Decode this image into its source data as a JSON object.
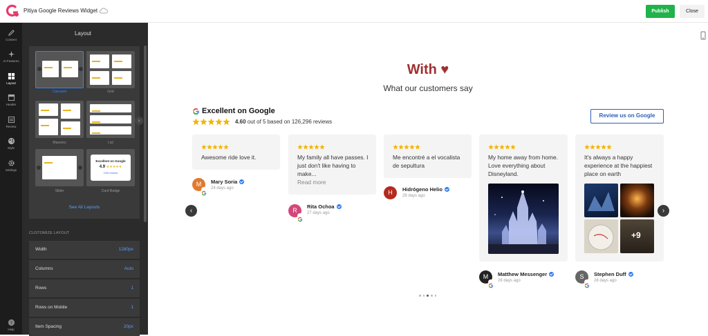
{
  "app": {
    "title": "Pitiya Google Reviews Widget",
    "publish_label": "Publish",
    "close_label": "Close"
  },
  "rail": [
    {
      "label": "Content",
      "icon": "pencil-icon"
    },
    {
      "label": "AI Features",
      "icon": "sparkle-icon"
    },
    {
      "label": "Layout",
      "icon": "layout-grid-icon"
    },
    {
      "label": "Header",
      "icon": "header-icon"
    },
    {
      "label": "Review",
      "icon": "review-icon"
    },
    {
      "label": "Style",
      "icon": "palette-icon"
    },
    {
      "label": "Settings",
      "icon": "gear-icon"
    },
    {
      "label": "Help",
      "icon": "help-icon"
    }
  ],
  "panel": {
    "title": "Layout",
    "layouts": [
      "Carousel",
      "Grid",
      "Masonry",
      "List",
      "Slider",
      "Card Badge"
    ],
    "selected": "Carousel",
    "badge_text": "Excellent on Google",
    "badge_rating": "4.9",
    "badge_link": "1000 reviews",
    "see_all": "See All Layouts",
    "customize_title": "CUSTOMIZE LAYOUT",
    "settings": [
      {
        "label": "Width",
        "value": "1280px"
      },
      {
        "label": "Columns",
        "value": "Auto"
      },
      {
        "label": "Rows",
        "value": "1"
      },
      {
        "label": "Rows on Mobile",
        "value": "1"
      },
      {
        "label": "Item Spacing",
        "value": "20px"
      }
    ]
  },
  "widget": {
    "heading": "With ♥",
    "subheading": "What our customers say",
    "summary_title": "Excellent on Google",
    "rating": "4.60",
    "rating_rest": " out of 5 based on 126,296 reviews",
    "review_button": "Review us on Google",
    "read_more": "Read more",
    "plus_more": "+9",
    "reviews": [
      {
        "text": "Awesome ride love it.",
        "author": "Mary Soria",
        "initial": "M",
        "date": "24 days ago",
        "color": "#e07a2e"
      },
      {
        "text": "My family all have passes. I just don't like having to make...",
        "author": "Rita Ochoa",
        "initial": "R",
        "date": "27 days ago",
        "color": "#d4477a"
      },
      {
        "text": "Me encontré a el vocalista de sepultura",
        "author": "Hidrógeno Helio",
        "initial": "H",
        "date": "28 days ago",
        "color": "#b52a1e"
      },
      {
        "text": "My home away from home. Love everything about Disneyland.",
        "author": "Matthew Messenger",
        "initial": "M",
        "date": "28 days ago",
        "color": "#222"
      },
      {
        "text": "It's always a happy experience at the happiest place on earth",
        "author": "Stephen Duff",
        "initial": "S",
        "date": "28 days ago",
        "color": "#666"
      }
    ]
  }
}
